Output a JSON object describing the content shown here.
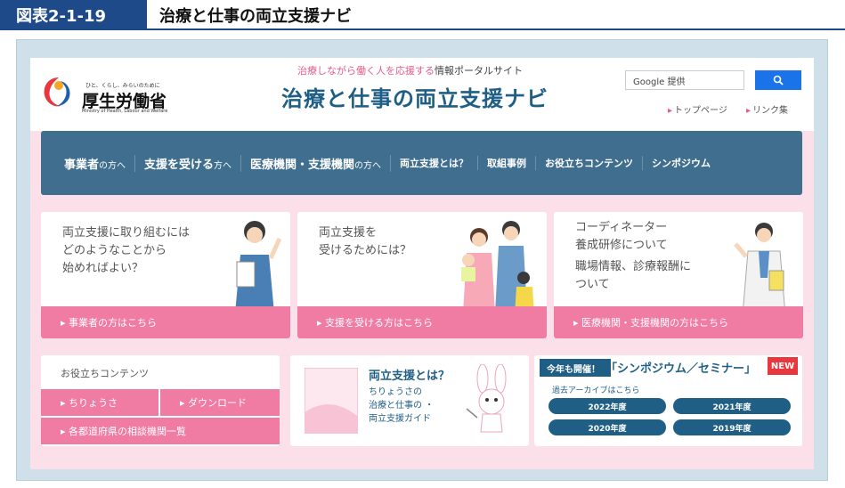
{
  "figure": {
    "label": "図表2-1-19",
    "title": "治療と仕事の両立支援ナビ"
  },
  "header": {
    "logo_sub": "ひと、くらし、みらいのために",
    "logo_main": "厚生労働省",
    "logo_en": "Ministry of Health, Labour and Welfare",
    "tagline_pink": "治療しながら働く人を応援する",
    "tagline_dark": "情報ポータルサイト",
    "site_title": "治療と仕事の両立支援ナビ",
    "search_placeholder": "Google 提供",
    "links": [
      "トップページ",
      "リンク集"
    ]
  },
  "nav": [
    {
      "main": "事業者",
      "small": "の方へ"
    },
    {
      "main": "支援を受ける",
      "small": "方へ"
    },
    {
      "main": "医療機関・支援機関",
      "small": "の方へ"
    },
    {
      "main": "両立支援とは？",
      "small": ""
    },
    {
      "main": "取組事例",
      "small": ""
    },
    {
      "main": "お役立ちコンテンツ",
      "small": ""
    },
    {
      "main": "シンポジウム",
      "small": ""
    }
  ],
  "cards": [
    {
      "lines": [
        "両立支援に取り組むには",
        "どのようなことから",
        "始めればよい？"
      ],
      "link": "事業者の方はこちら"
    },
    {
      "lines": [
        "両立支援を",
        "受けるためには？"
      ],
      "link": "支援を受ける方はこちら"
    },
    {
      "lines": [
        "コーディネーター",
        "養成研修について",
        "職場情報、診療報酬に",
        "ついて"
      ],
      "link": "医療機関・支援機関の方はこちら"
    }
  ],
  "contents": {
    "header": "お役立ちコンテンツ",
    "btn1": "ちりょうさ",
    "btn2": "ダウンロード",
    "btn3": "各都道府県の相談機関一覧"
  },
  "guide": {
    "title": "両立支援とは？",
    "lines": [
      "ちりょうさの",
      "治療と仕事の ・",
      "両立支援ガイド"
    ]
  },
  "symposium": {
    "badge": "今年も開催！",
    "title": "「シンポジウム／セミナー」",
    "new": "NEW",
    "archive": "過去アーカイブはこちら",
    "years": [
      "2022年度",
      "2021年度",
      "2020年度",
      "2019年度"
    ]
  },
  "colors": {
    "brand_blue": "#1e4a8a",
    "nav": "#3f6e8e",
    "pink": "#f07ba3",
    "site_bg": "#fbe0ea"
  }
}
